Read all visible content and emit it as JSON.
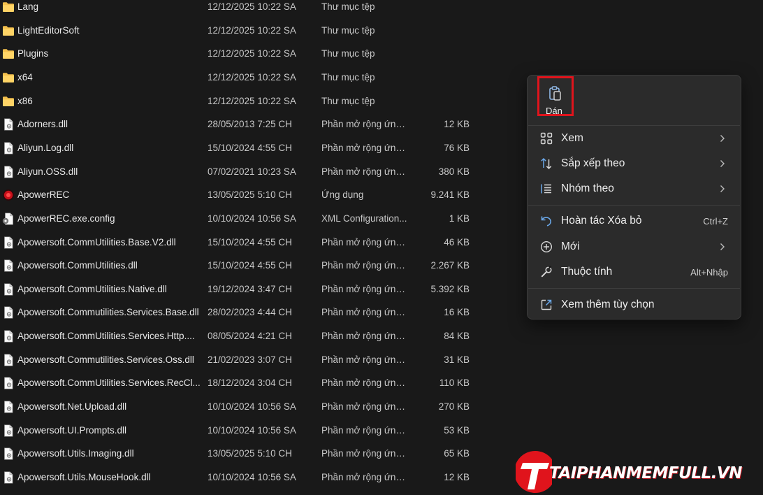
{
  "files": [
    {
      "name": "Lang",
      "date": "12/12/2025 10:22 SA",
      "type": "Thư mục tệp",
      "size": "",
      "icon": "folder-icon"
    },
    {
      "name": "LightEditorSoft",
      "date": "12/12/2025 10:22 SA",
      "type": "Thư mục tệp",
      "size": "",
      "icon": "folder-icon"
    },
    {
      "name": "Plugins",
      "date": "12/12/2025 10:22 SA",
      "type": "Thư mục tệp",
      "size": "",
      "icon": "folder-icon"
    },
    {
      "name": "x64",
      "date": "12/12/2025 10:22 SA",
      "type": "Thư mục tệp",
      "size": "",
      "icon": "folder-icon"
    },
    {
      "name": "x86",
      "date": "12/12/2025 10:22 SA",
      "type": "Thư mục tệp",
      "size": "",
      "icon": "folder-icon"
    },
    {
      "name": "Adorners.dll",
      "date": "28/05/2013 7:25 CH",
      "type": "Phần mở rộng ứng...",
      "size": "12 KB",
      "icon": "file-icon"
    },
    {
      "name": "Aliyun.Log.dll",
      "date": "15/10/2024 4:55 CH",
      "type": "Phần mở rộng ứng...",
      "size": "76 KB",
      "icon": "file-icon"
    },
    {
      "name": "Aliyun.OSS.dll",
      "date": "07/02/2021 10:23 SA",
      "type": "Phần mở rộng ứng...",
      "size": "380 KB",
      "icon": "file-icon"
    },
    {
      "name": "ApowerREC",
      "date": "13/05/2025 5:10 CH",
      "type": "Ứng dụng",
      "size": "9.241 KB",
      "icon": "app-icon"
    },
    {
      "name": "ApowerREC.exe.config",
      "date": "10/10/2024 10:56 SA",
      "type": "XML Configuration...",
      "size": "1 KB",
      "icon": "config-file-icon"
    },
    {
      "name": "Apowersoft.CommUtilities.Base.V2.dll",
      "date": "15/10/2024 4:55 CH",
      "type": "Phần mở rộng ứng...",
      "size": "46 KB",
      "icon": "file-icon"
    },
    {
      "name": "Apowersoft.CommUtilities.dll",
      "date": "15/10/2024 4:55 CH",
      "type": "Phần mở rộng ứng...",
      "size": "2.267 KB",
      "icon": "file-icon"
    },
    {
      "name": "Apowersoft.CommUtilities.Native.dll",
      "date": "19/12/2024 3:47 CH",
      "type": "Phần mở rộng ứng...",
      "size": "5.392 KB",
      "icon": "file-icon"
    },
    {
      "name": "Apowersoft.Commutilities.Services.Base.dll",
      "date": "28/02/2023 4:44 CH",
      "type": "Phần mở rộng ứng...",
      "size": "16 KB",
      "icon": "file-icon"
    },
    {
      "name": "Apowersoft.CommUtilities.Services.Http....",
      "date": "08/05/2024 4:21 CH",
      "type": "Phần mở rộng ứng...",
      "size": "84 KB",
      "icon": "file-icon"
    },
    {
      "name": "Apowersoft.Commutilities.Services.Oss.dll",
      "date": "21/02/2023 3:07 CH",
      "type": "Phần mở rộng ứng...",
      "size": "31 KB",
      "icon": "file-icon"
    },
    {
      "name": "Apowersoft.CommUtilities.Services.RecCl...",
      "date": "18/12/2024 3:04 CH",
      "type": "Phần mở rộng ứng...",
      "size": "110 KB",
      "icon": "file-icon"
    },
    {
      "name": "Apowersoft.Net.Upload.dll",
      "date": "10/10/2024 10:56 SA",
      "type": "Phần mở rộng ứng...",
      "size": "270 KB",
      "icon": "file-icon"
    },
    {
      "name": "Apowersoft.UI.Prompts.dll",
      "date": "10/10/2024 10:56 SA",
      "type": "Phần mở rộng ứng...",
      "size": "53 KB",
      "icon": "file-icon"
    },
    {
      "name": "Apowersoft.Utils.Imaging.dll",
      "date": "13/05/2025 5:10 CH",
      "type": "Phần mở rộng ứng...",
      "size": "65 KB",
      "icon": "file-icon"
    },
    {
      "name": "Apowersoft.Utils.MouseHook.dll",
      "date": "10/10/2024 10:56 SA",
      "type": "Phần mở rộng ứng...",
      "size": "12 KB",
      "icon": "file-icon"
    }
  ],
  "context_menu": {
    "paste_label": "Dán",
    "paste_icon": "clipboard-icon",
    "items": [
      {
        "label": "Xem",
        "icon": "grid-view-icon",
        "shortcut": "",
        "submenu": true
      },
      {
        "label": "Sắp xếp theo",
        "icon": "sort-icon",
        "shortcut": "",
        "submenu": true
      },
      {
        "label": "Nhóm theo",
        "icon": "group-icon",
        "shortcut": "",
        "submenu": true
      },
      {
        "label": "Hoàn tác Xóa bỏ",
        "icon": "undo-icon",
        "shortcut": "Ctrl+Z",
        "submenu": false
      },
      {
        "label": "Mới",
        "icon": "new-icon",
        "shortcut": "",
        "submenu": true
      },
      {
        "label": "Thuộc tính",
        "icon": "wrench-icon",
        "shortcut": "Alt+Nhập",
        "submenu": false
      },
      {
        "label": "Xem thêm tùy chọn",
        "icon": "more-options-icon",
        "shortcut": "",
        "submenu": false
      }
    ]
  },
  "watermark": {
    "text": "TAIPHANMEMFULL.VN",
    "logo_letter": "T"
  },
  "colors": {
    "folder": "#f4c04d",
    "highlight_border": "#e0141c",
    "accent_blue": "#6aa7e8",
    "watermark_red": "#e0141c"
  }
}
